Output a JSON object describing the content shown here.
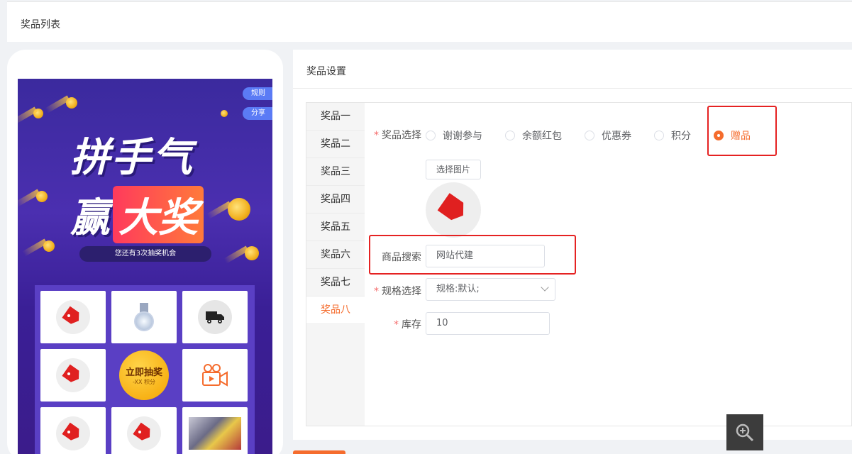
{
  "page": {
    "title": "奖品列表"
  },
  "preview": {
    "rules_label": "规则",
    "share_label": "分享",
    "headline_line1": "拼手气",
    "headline_line2a": "赢",
    "headline_line2b": "大奖",
    "chances_text": "您还有3次抽奖机会",
    "draw_button": "立即抽奖",
    "draw_cost": "-XX 积分"
  },
  "panel": {
    "title": "奖品设置",
    "tabs": [
      "奖品一",
      "奖品二",
      "奖品三",
      "奖品四",
      "奖品五",
      "奖品六",
      "奖品七",
      "奖品八"
    ],
    "active_tab": "奖品八",
    "form": {
      "prize_type_label": "奖品选择",
      "prize_types": [
        "谢谢参与",
        "余额红包",
        "优惠券",
        "积分",
        "赠品"
      ],
      "selected_type": "赠品",
      "pick_image_button": "选择图片",
      "product_search_label": "商品搜索",
      "product_search_value": "网站代建",
      "spec_label": "规格选择",
      "spec_value": "规格:默认;",
      "stock_label": "库存",
      "stock_value": "10"
    }
  },
  "colors": {
    "accent": "#f56c2d",
    "highlight": "#e52222",
    "required": "#f56c6c"
  },
  "icons": [
    "tag-icon",
    "medal-icon",
    "truck-icon",
    "camera-icon",
    "zoom-in-icon"
  ]
}
